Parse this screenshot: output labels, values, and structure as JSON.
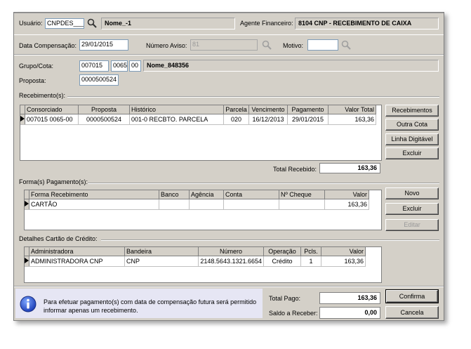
{
  "header": {
    "usuario_label": "Usuário:",
    "usuario_value": "CNPDES____",
    "usuario_name": "Nome_-1",
    "agente_label": "Agente Financeiro:",
    "agente_value": "8104  CNP - RECEBIMENTO DE CAIXA"
  },
  "filters": {
    "data_comp_label": "Data Compensação:",
    "data_comp_value": "29/01/2015",
    "num_aviso_label": "Número Aviso:",
    "num_aviso_value": "81",
    "motivo_label": "Motivo:",
    "motivo_value": "",
    "grupo_label": "Grupo/Cota:",
    "grupo_value": "007015",
    "cota_value": "0065",
    "digito_value": "00",
    "grupo_name": "Nome_848356",
    "proposta_label": "Proposta:",
    "proposta_value": "0000500524"
  },
  "recebimentos": {
    "section_label": "Recebimento(s):",
    "columns": [
      "Consorciado",
      "Proposta",
      "Histórico",
      "Parcela",
      "Vencimento",
      "Pagamento",
      "Valor Total"
    ],
    "rows": [
      [
        "007015 0065-00",
        "0000500524",
        "001-0 RECBTO. PARCELA",
        "020",
        "16/12/2013",
        "29/01/2015",
        "163,36"
      ]
    ],
    "total_label": "Total Recebido:",
    "total_value": "163,36",
    "buttons": [
      "Recebimentos",
      "Outra Cota",
      "Linha Digitável",
      "Excluir"
    ]
  },
  "formas": {
    "section_label": "Forma(s) Pagamento(s):",
    "columns": [
      "Forma Recebimento",
      "Banco",
      "Agência",
      "Conta",
      "Nº Cheque",
      "Valor"
    ],
    "rows": [
      [
        "CARTÃO",
        "",
        "",
        "",
        "",
        "163,36"
      ]
    ],
    "buttons": [
      "Novo",
      "Excluir",
      "Editar"
    ]
  },
  "cartao": {
    "section_label": "Detalhes Cartão de Crédito:",
    "columns": [
      "Administradora",
      "Bandeira",
      "Número",
      "Operação",
      "Pcls.",
      "Valor"
    ],
    "rows": [
      [
        "ADMINISTRADORA CNP",
        "CNP",
        "2148.5643.1321.6654",
        "Crédito",
        "1",
        "163,36"
      ]
    ]
  },
  "footer": {
    "info_line1": "Para efetuar pagamento(s) com data de compensação futura será permitido",
    "info_line2": "informar apenas um recebimento.",
    "total_pago_label": "Total Pago:",
    "total_pago_value": "163,36",
    "saldo_label": "Saldo a Receber:",
    "saldo_value": "0,00",
    "confirma_label": "Confirma",
    "cancela_label": "Cancela"
  },
  "icons": {
    "search": "magnifier-icon",
    "info": "info-icon",
    "row_pointer": "row-pointer-icon"
  }
}
